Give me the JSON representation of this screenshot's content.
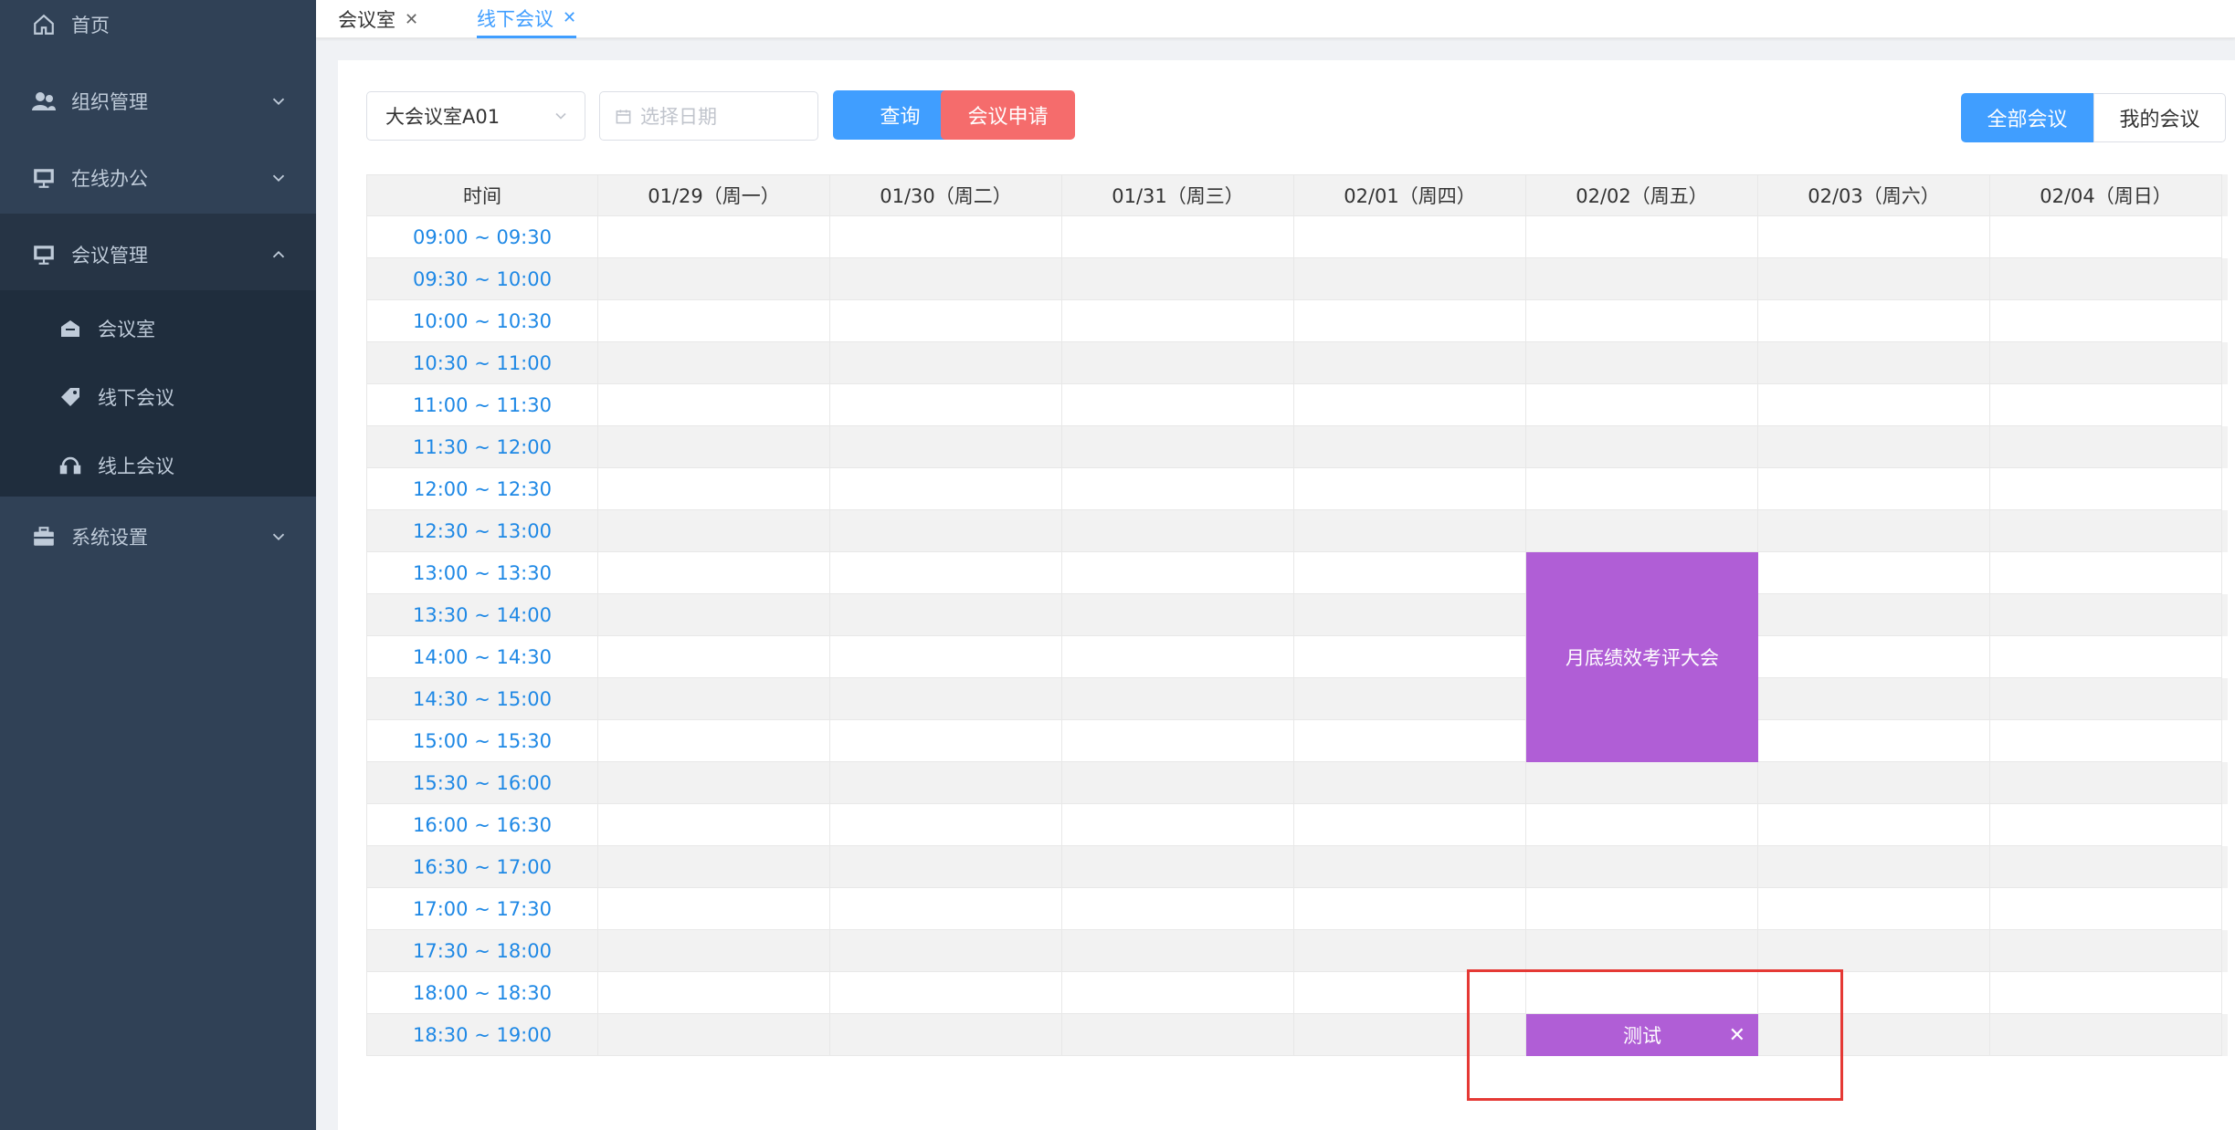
{
  "sidebar": {
    "items": [
      {
        "label": "首页",
        "icon": "home-icon"
      },
      {
        "label": "组织管理",
        "icon": "users-icon"
      },
      {
        "label": "在线办公",
        "icon": "board-icon"
      },
      {
        "label": "会议管理",
        "icon": "board-icon"
      },
      {
        "label": "系统设置",
        "icon": "toolbox-icon"
      }
    ],
    "sub_items": [
      {
        "label": "会议室",
        "icon": "room-icon"
      },
      {
        "label": "线下会议",
        "icon": "tag-icon"
      },
      {
        "label": "线上会议",
        "icon": "headset-icon"
      }
    ]
  },
  "tabs": [
    {
      "label": "会议室",
      "close": "✕",
      "active": false
    },
    {
      "label": "线下会议",
      "close": "✕",
      "active": true
    }
  ],
  "toolbar": {
    "room_select": "大会议室A01",
    "date_placeholder": "选择日期",
    "query_label": "查询",
    "apply_label": "会议申请",
    "all_label": "全部会议",
    "mine_label": "我的会议"
  },
  "schedule": {
    "header": [
      "时间",
      "01/29（周一）",
      "01/30（周二）",
      "01/31（周三）",
      "02/01（周四）",
      "02/02（周五）",
      "02/03（周六）",
      "02/04（周日）"
    ],
    "times": [
      "09:00 ~ 09:30",
      "09:30 ~ 10:00",
      "10:00 ~ 10:30",
      "10:30 ~ 11:00",
      "11:00 ~ 11:30",
      "11:30 ~ 12:00",
      "12:00 ~ 12:30",
      "12:30 ~ 13:00",
      "13:00 ~ 13:30",
      "13:30 ~ 14:00",
      "14:00 ~ 14:30",
      "14:30 ~ 15:00",
      "15:00 ~ 15:30",
      "15:30 ~ 16:00",
      "16:00 ~ 16:30",
      "16:30 ~ 17:00",
      "17:00 ~ 17:30",
      "17:30 ~ 18:00",
      "18:00 ~ 18:30",
      "18:30 ~ 19:00"
    ],
    "events": [
      {
        "title": "月底绩效考评大会",
        "day": "02/02（周五）",
        "start": "13:00",
        "end": "15:30",
        "color": "#b05ed6"
      },
      {
        "title": "测试",
        "day": "02/02（周五）",
        "start": "18:30",
        "end": "19:00",
        "color": "#b05ed6",
        "close": "✕"
      }
    ]
  },
  "colors": {
    "sidebar_bg": "#304156",
    "accent": "#409eff",
    "danger": "#f56c6c",
    "event": "#b05ed6"
  }
}
